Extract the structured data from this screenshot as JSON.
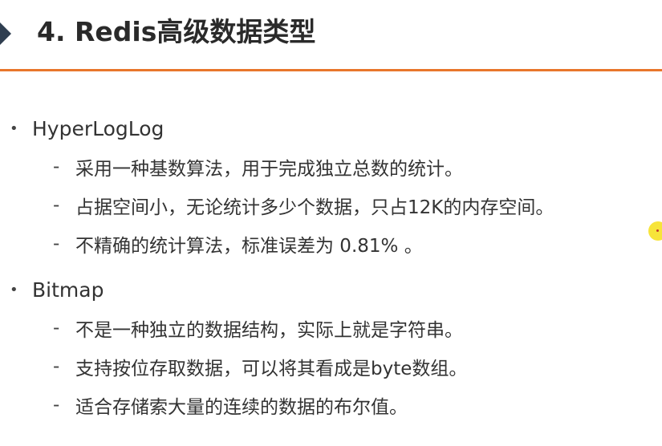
{
  "title": "4. Redis高级数据类型",
  "sections": [
    {
      "heading": "HyperLogLog",
      "items": [
        "采用一种基数算法，用于完成独立总数的统计。",
        "占据空间小，无论统计多少个数据，只占12K的内存空间。",
        "不精确的统计算法，标准误差为 0.81% 。"
      ]
    },
    {
      "heading": "Bitmap",
      "items": [
        "不是一种独立的数据结构，实际上就是字符串。",
        "支持按位存取数据，可以将其看成是byte数组。",
        "适合存储索大量的连续的数据的布尔值。"
      ]
    }
  ],
  "glyphs": {
    "bullet": "•",
    "dash": "-"
  },
  "colors": {
    "accent_rule": "#e8762b",
    "title_marker": "#2f3e50",
    "pointer": "#f7e43a"
  }
}
